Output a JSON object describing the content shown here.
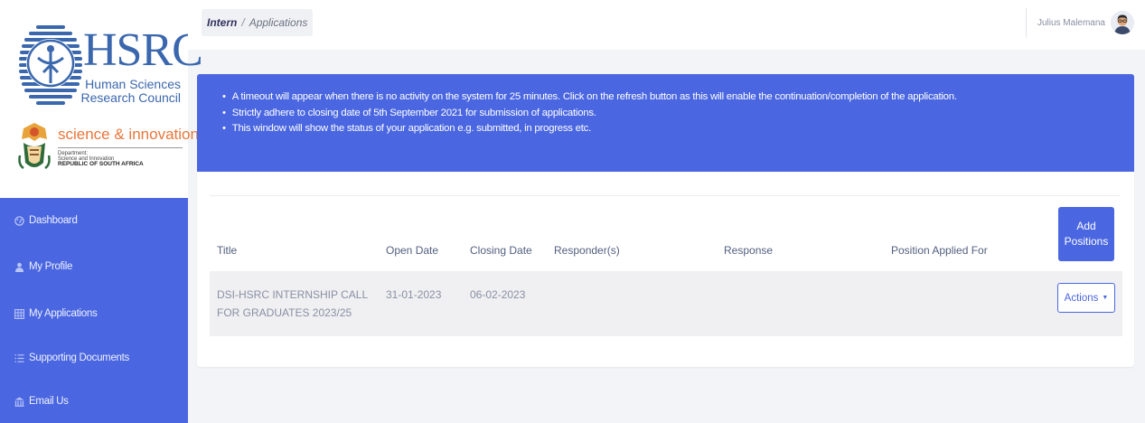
{
  "brand": {
    "hsrc": "HSRC",
    "hsrc_line1": "Human Sciences",
    "hsrc_line2": "Research Council",
    "dsi_title": "science & innovation",
    "dsi_line1": "Department:",
    "dsi_line2": "Science and Innovation",
    "dsi_line3": "REPUBLIC OF SOUTH AFRICA"
  },
  "sidebar": {
    "items": [
      {
        "label": "Dashboard",
        "icon": "dashboard-icon"
      },
      {
        "label": "My Profile",
        "icon": "user-icon"
      },
      {
        "label": "My Applications",
        "icon": "grid-icon"
      },
      {
        "label": "Supporting Documents",
        "icon": "list-icon"
      },
      {
        "label": "Email Us",
        "icon": "building-icon"
      }
    ]
  },
  "header": {
    "breadcrumb": [
      "Intern",
      "Applications"
    ],
    "separator": "/",
    "user_name": "Julius Malemana"
  },
  "notice": {
    "items": [
      "A timeout will appear when there is no activity on the system for 25 minutes. Click on the refresh button as this will enable the continuation/completion of the application.",
      "Strictly adhere to closing date of 5th September 2021 for submission of applications.",
      "This window will show the status of your application e.g. submitted, in progress etc."
    ]
  },
  "table": {
    "columns": [
      "Title",
      "Open Date",
      "Closing Date",
      "Responder(s)",
      "Response",
      "Position Applied For"
    ],
    "add_button": "Add Positions",
    "rows": [
      {
        "title": "DSI-HSRC INTERNSHIP CALL FOR GRADUATES 2023/25",
        "open_date": "31-01-2023",
        "closing_date": "06-02-2023",
        "responders": "",
        "response": "",
        "position": "",
        "actions_label": "Actions"
      }
    ]
  },
  "colors": {
    "primary": "#4a66e0",
    "brand_blue": "#3a67ad",
    "brand_orange": "#e8763a"
  }
}
